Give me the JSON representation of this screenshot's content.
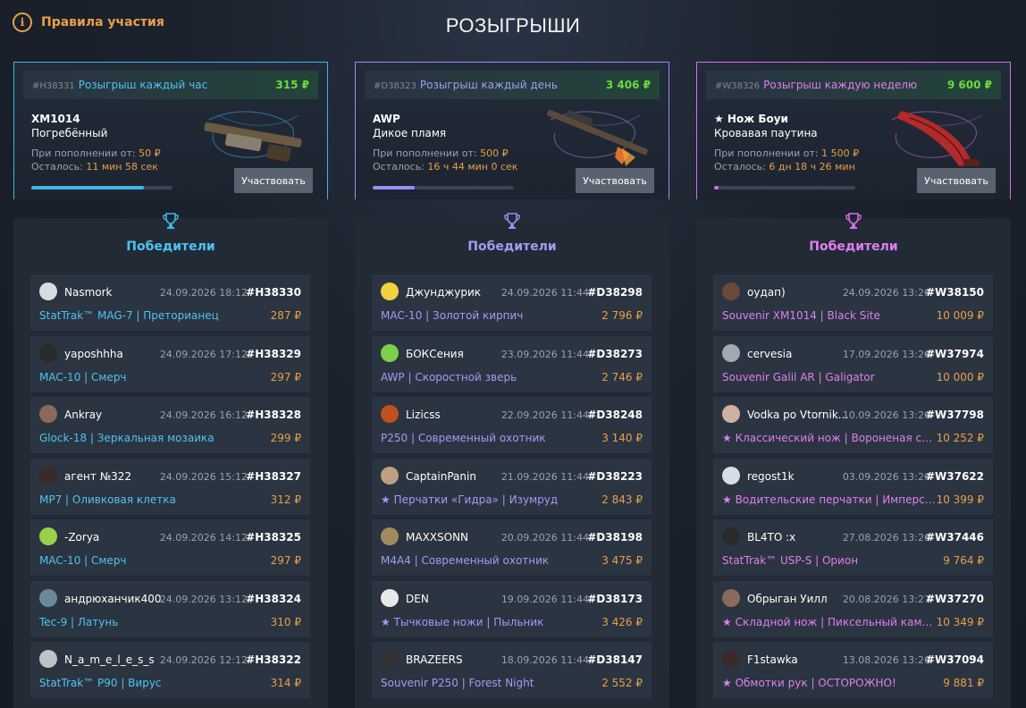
{
  "header": {
    "rules_label": "Правила участия",
    "rules_icon": "info-icon",
    "title": "РОЗЫГРЫШИ"
  },
  "colors": {
    "hourly": "#3fb6e8",
    "daily": "#9a8cf2",
    "weekly": "#d96ee8",
    "price": "#e8a04a",
    "prize": "#6bdc3a"
  },
  "lotteries": [
    {
      "id": "#H38331",
      "name": "Розыгрыш каждый час",
      "prize": "315 ₽",
      "weapon": "XM1014",
      "skin": "Погребённый",
      "condition_label": "При пополнении от:",
      "condition_value": "50 ₽",
      "left_label": "Осталось:",
      "left_value": "11 мин 58 сек",
      "progress": 0.8,
      "button": "Участвовать",
      "winners_title": "Победители"
    },
    {
      "id": "#D38323",
      "name": "Розыгрыш каждый день",
      "prize": "3 406 ₽",
      "weapon": "AWP",
      "skin": "Дикое пламя",
      "condition_label": "При пополнении от:",
      "condition_value": "500 ₽",
      "left_label": "Осталось:",
      "left_value": "16 ч 44 мин 0 сек",
      "progress": 0.3,
      "button": "Участвовать",
      "winners_title": "Победители"
    },
    {
      "id": "#W38326",
      "name": "Розыгрыш каждую неделю",
      "prize": "9 600 ₽",
      "weapon": "★ Нож Боуи",
      "skin": "Кровавая паутина",
      "condition_label": "При пополнении от:",
      "condition_value": "1 500 ₽",
      "left_label": "Осталось:",
      "left_value": "6 дн 18 ч 26 мин",
      "progress": 0.03,
      "button": "Участвовать",
      "winners_title": "Победители"
    }
  ],
  "winners": [
    [
      {
        "user": "Nasmork",
        "date": "24.09.2026 18:12",
        "id": "#H38330",
        "item": "StatTrak™ MAG-7 | Преторианец",
        "price": "287 ₽"
      },
      {
        "user": "yaposhhha",
        "date": "24.09.2026 17:12",
        "id": "#H38329",
        "item": "MAC-10 | Смерч",
        "price": "297 ₽"
      },
      {
        "user": "Ankray",
        "date": "24.09.2026 16:12",
        "id": "#H38328",
        "item": "Glock-18 | Зеркальная мозаика",
        "price": "299 ₽"
      },
      {
        "user": "агент №322",
        "date": "24.09.2026 15:12",
        "id": "#H38327",
        "item": "MP7 | Оливковая клетка",
        "price": "312 ₽"
      },
      {
        "user": "-Zorya",
        "date": "24.09.2026 14:12",
        "id": "#H38325",
        "item": "MAC-10 | Смерч",
        "price": "297 ₽"
      },
      {
        "user": "андрюханчик400",
        "date": "24.09.2026 13:12",
        "id": "#H38324",
        "item": "Tec-9 | Латунь",
        "price": "310 ₽"
      },
      {
        "user": "N_a_m_e_l_e_s_s",
        "date": "24.09.2026 12:12",
        "id": "#H38322",
        "item": "StatTrak™ P90 | Вирус",
        "price": "314 ₽"
      }
    ],
    [
      {
        "user": "Джунджурик",
        "date": "24.09.2026 11:44",
        "id": "#D38298",
        "item": "MAC-10 | Золотой кирпич",
        "price": "2 796 ₽"
      },
      {
        "user": "БОКСения",
        "date": "23.09.2026 11:44",
        "id": "#D38273",
        "item": "AWP | Скоростной зверь",
        "price": "2 746 ₽"
      },
      {
        "user": "Lizicss",
        "date": "22.09.2026 11:44",
        "id": "#D38248",
        "item": "P250 | Современный охотник",
        "price": "3 140 ₽"
      },
      {
        "user": "CaptainPanin",
        "date": "21.09.2026 11:44",
        "id": "#D38223",
        "item": "★ Перчатки «Гидра» | Изумруд",
        "price": "2 843 ₽"
      },
      {
        "user": "MAXXSONN",
        "date": "20.09.2026 11:44",
        "id": "#D38198",
        "item": "M4A4 | Современный охотник",
        "price": "3 475 ₽"
      },
      {
        "user": "DEN",
        "date": "19.09.2026 11:44",
        "id": "#D38173",
        "item": "★ Тычковые ножи | Пыльник",
        "price": "3 426 ₽"
      },
      {
        "user": "BRAZEERS",
        "date": "18.09.2026 11:44",
        "id": "#D38147",
        "item": "Souvenir P250 | Forest Night",
        "price": "2 552 ₽"
      }
    ],
    [
      {
        "user": "oyдап)",
        "date": "24.09.2026 13:26",
        "id": "#W38150",
        "item": "Souvenir XM1014 | Black Site",
        "price": "10 009 ₽"
      },
      {
        "user": "cervesia",
        "date": "17.09.2026 13:26",
        "id": "#W37974",
        "item": "Souvenir Galil AR | Galigator",
        "price": "10 000 ₽"
      },
      {
        "user": "Vodka po Vtornika...",
        "date": "10.09.2026 13:26",
        "id": "#W37798",
        "item": "★ Классический нож | Вороненая сталь",
        "price": "10 252 ₽"
      },
      {
        "user": "regost1k",
        "date": "03.09.2026 13:26",
        "id": "#W37622",
        "item": "★ Водительские перчатки | Имперская...",
        "price": "10 399 ₽"
      },
      {
        "user": "BL4TO :x",
        "date": "27.08.2026 13:26",
        "id": "#W37446",
        "item": "StatTrak™ USP-S | Орион",
        "price": "9 764 ₽"
      },
      {
        "user": "Обрыган Уилл",
        "date": "20.08.2026 13:27",
        "id": "#W37270",
        "item": "★ Складной нож | Пиксельный камуф...",
        "price": "10 349 ₽"
      },
      {
        "user": "F1stawka",
        "date": "13.08.2026 13:26",
        "id": "#W37094",
        "item": "★ Обмотки рук | ОСТОРОЖНО!",
        "price": "9 881 ₽"
      }
    ]
  ]
}
